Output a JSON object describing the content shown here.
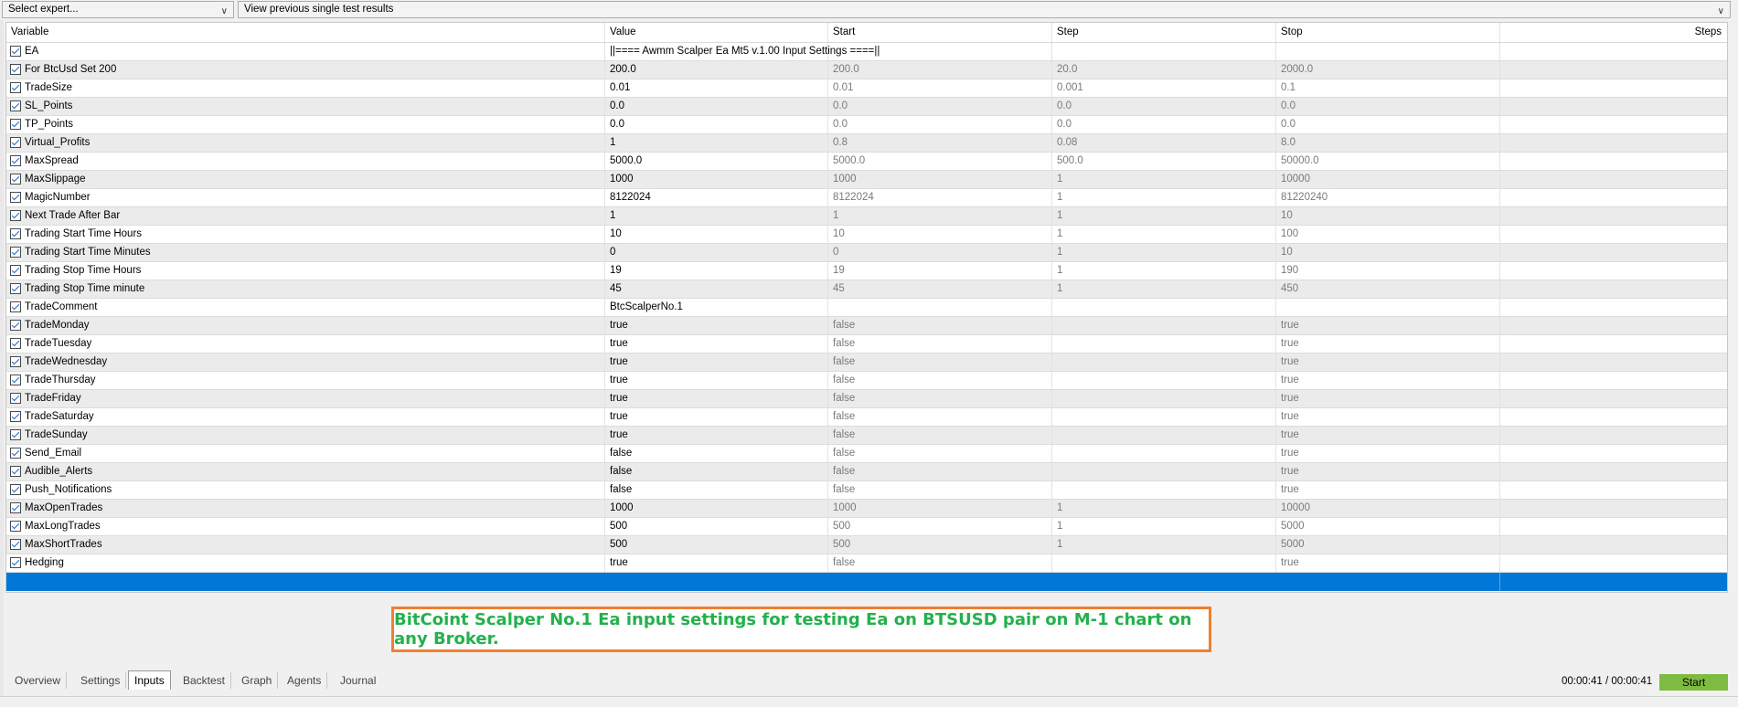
{
  "top": {
    "expert_select": "Select expert...",
    "results_select": "View previous single test results"
  },
  "columns": [
    "Variable",
    "Value",
    "Start",
    "Step",
    "Stop",
    "Steps"
  ],
  "rows": [
    {
      "var": "EA",
      "value": "||==== Awmm Scalper Ea Mt5 v.1.00 Input Settings ====||",
      "start": "",
      "step": "",
      "stop": ""
    },
    {
      "var": "For BtcUsd Set 200",
      "value": "200.0",
      "start": "200.0",
      "step": "20.0",
      "stop": "2000.0"
    },
    {
      "var": "TradeSize",
      "value": "0.01",
      "start": "0.01",
      "step": "0.001",
      "stop": "0.1"
    },
    {
      "var": "SL_Points",
      "value": "0.0",
      "start": "0.0",
      "step": "0.0",
      "stop": "0.0"
    },
    {
      "var": "TP_Points",
      "value": "0.0",
      "start": "0.0",
      "step": "0.0",
      "stop": "0.0"
    },
    {
      "var": "Virtual_Profits",
      "value": "1",
      "start": "0.8",
      "step": "0.08",
      "stop": "8.0"
    },
    {
      "var": "MaxSpread",
      "value": "5000.0",
      "start": "5000.0",
      "step": "500.0",
      "stop": "50000.0"
    },
    {
      "var": "MaxSlippage",
      "value": "1000",
      "start": "1000",
      "step": "1",
      "stop": "10000"
    },
    {
      "var": "MagicNumber",
      "value": "8122024",
      "start": "8122024",
      "step": "1",
      "stop": "81220240"
    },
    {
      "var": "Next Trade After Bar",
      "value": "1",
      "start": "1",
      "step": "1",
      "stop": "10"
    },
    {
      "var": "Trading Start Time Hours",
      "value": "10",
      "start": "10",
      "step": "1",
      "stop": "100"
    },
    {
      "var": "Trading Start Time Minutes",
      "value": "0",
      "start": "0",
      "step": "1",
      "stop": "10"
    },
    {
      "var": "Trading Stop Time Hours",
      "value": "19",
      "start": "19",
      "step": "1",
      "stop": "190"
    },
    {
      "var": "Trading Stop Time minute",
      "value": "45",
      "start": "45",
      "step": "1",
      "stop": "450"
    },
    {
      "var": "TradeComment",
      "value": "BtcScalperNo.1",
      "start": "",
      "step": "",
      "stop": ""
    },
    {
      "var": "TradeMonday",
      "value": "true",
      "start": "false",
      "step": "",
      "stop": "true"
    },
    {
      "var": "TradeTuesday",
      "value": "true",
      "start": "false",
      "step": "",
      "stop": "true"
    },
    {
      "var": "TradeWednesday",
      "value": "true",
      "start": "false",
      "step": "",
      "stop": "true"
    },
    {
      "var": "TradeThursday",
      "value": "true",
      "start": "false",
      "step": "",
      "stop": "true"
    },
    {
      "var": "TradeFriday",
      "value": "true",
      "start": "false",
      "step": "",
      "stop": "true"
    },
    {
      "var": "TradeSaturday",
      "value": "true",
      "start": "false",
      "step": "",
      "stop": "true"
    },
    {
      "var": "TradeSunday",
      "value": "true",
      "start": "false",
      "step": "",
      "stop": "true"
    },
    {
      "var": "Send_Email",
      "value": "false",
      "start": "false",
      "step": "",
      "stop": "true"
    },
    {
      "var": "Audible_Alerts",
      "value": "false",
      "start": "false",
      "step": "",
      "stop": "true"
    },
    {
      "var": "Push_Notifications",
      "value": "false",
      "start": "false",
      "step": "",
      "stop": "true"
    },
    {
      "var": "MaxOpenTrades",
      "value": "1000",
      "start": "1000",
      "step": "1",
      "stop": "10000"
    },
    {
      "var": "MaxLongTrades",
      "value": "500",
      "start": "500",
      "step": "1",
      "stop": "5000"
    },
    {
      "var": "MaxShortTrades",
      "value": "500",
      "start": "500",
      "step": "1",
      "stop": "5000"
    },
    {
      "var": "Hedging",
      "value": "true",
      "start": "false",
      "step": "",
      "stop": "true"
    }
  ],
  "notice": "BitCoint Scalper No.1 Ea input settings for testing Ea on BTSUSD pair on M-1 chart on any Broker.",
  "tabs": [
    "Overview",
    "Settings",
    "Inputs",
    "Backtest",
    "Graph",
    "Agents",
    "Journal"
  ],
  "active_tab": "Inputs",
  "timer": "00:00:41 / 00:00:41",
  "start_button": "Start",
  "colors": {
    "selection": "#0078d7",
    "notice_border": "#f08030",
    "notice_text": "#22b14c",
    "start_button": "#7ebb40"
  }
}
